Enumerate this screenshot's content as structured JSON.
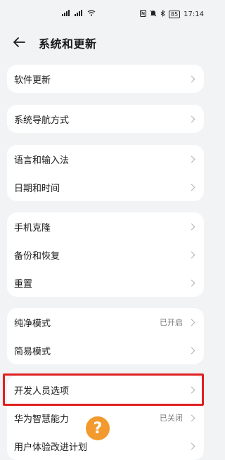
{
  "statusbar": {
    "network_left": "⁴⁶ᵢₗ ⁴⁶ᵢₗ",
    "wifi": "wifi-icon",
    "right_icons": [
      "nfc-icon",
      "mute-icon",
      "bluetooth-icon"
    ],
    "battery": "85",
    "time": "17:14"
  },
  "header": {
    "title": "系统和更新",
    "back_icon": "back-arrow-icon"
  },
  "cards": [
    {
      "items": [
        {
          "label": "软件更新",
          "value": ""
        }
      ]
    },
    {
      "items": [
        {
          "label": "系统导航方式",
          "value": ""
        }
      ]
    },
    {
      "items": [
        {
          "label": "语言和输入法",
          "value": ""
        },
        {
          "label": "日期和时间",
          "value": ""
        }
      ]
    },
    {
      "items": [
        {
          "label": "手机克隆",
          "value": ""
        },
        {
          "label": "备份和恢复",
          "value": ""
        },
        {
          "label": "重置",
          "value": ""
        }
      ]
    },
    {
      "items": [
        {
          "label": "纯净模式",
          "value": "已开启"
        },
        {
          "label": "简易模式",
          "value": ""
        }
      ]
    },
    {
      "items": [
        {
          "label": "开发人员选项",
          "value": ""
        },
        {
          "label": "华为智慧能力",
          "value": "已关闭"
        },
        {
          "label": "用户体验改进计划",
          "value": ""
        }
      ]
    }
  ],
  "overlay": {
    "help_symbol": "?",
    "help_color": "#f29a2e",
    "highlight_color": "#e02020"
  }
}
